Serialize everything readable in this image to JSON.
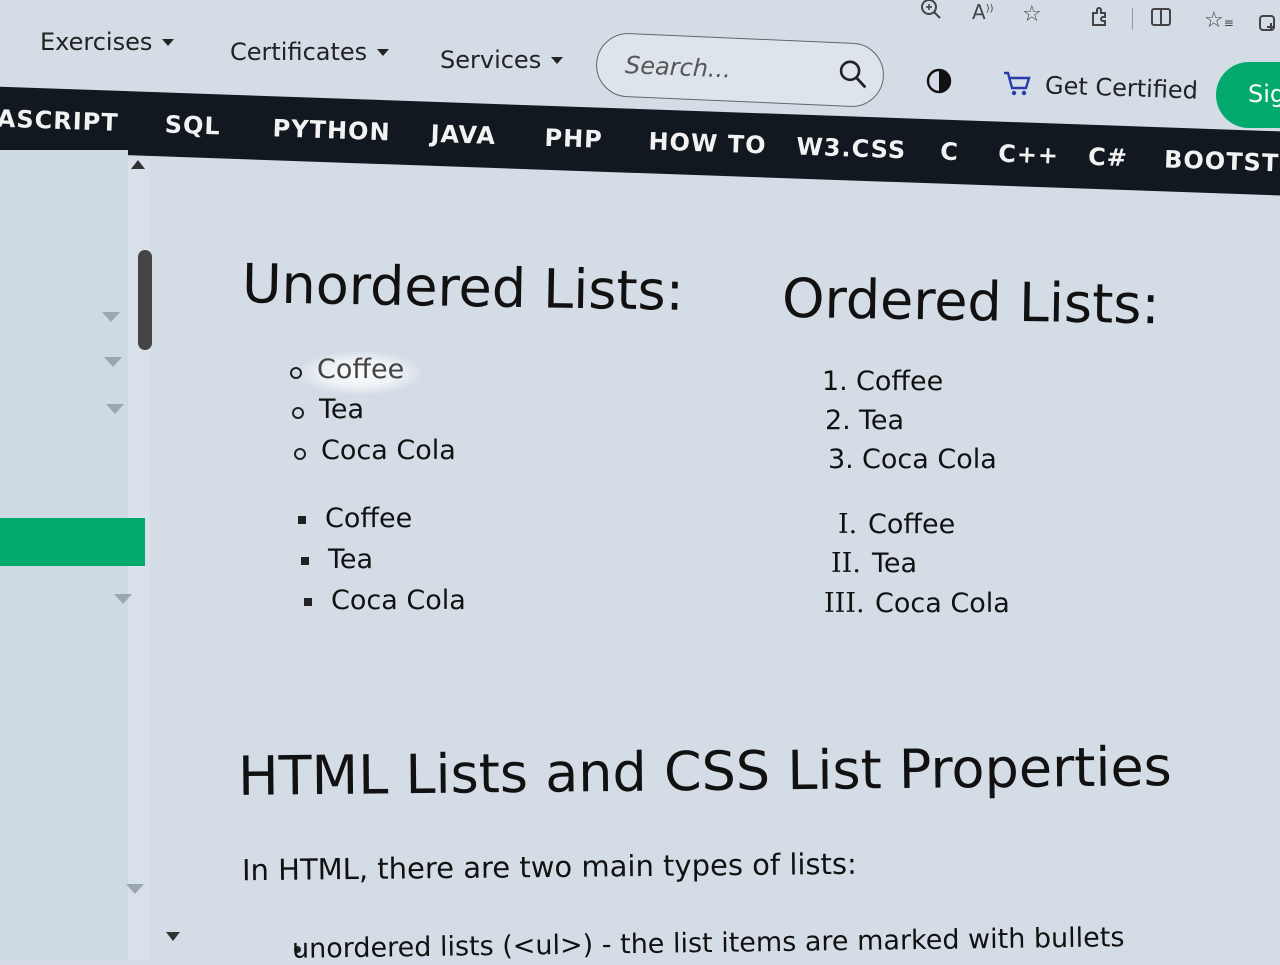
{
  "topnav": {
    "menus": [
      {
        "label": "Exercises"
      },
      {
        "label": "Certificates"
      },
      {
        "label": "Services"
      }
    ],
    "search": {
      "placeholder": "Search..."
    },
    "get_certified": "Get Certified",
    "signup": "Sig"
  },
  "browser_icons": [
    "zoom-in-icon",
    "read-aloud-icon",
    "favorite-star-icon",
    "extensions-icon",
    "split-screen-icon",
    "favorites-list-icon",
    "collections-icon"
  ],
  "langbar": {
    "items": [
      "ASCRIPT",
      "SQL",
      "PYTHON",
      "JAVA",
      "PHP",
      "HOW TO",
      "W3.CSS",
      "C",
      "C++",
      "C#",
      "BOOTSTRA"
    ]
  },
  "content": {
    "unordered_title": "Unordered Lists:",
    "ordered_title": "Ordered Lists:",
    "ul_circle": [
      "Coffee",
      "Tea",
      "Coca Cola"
    ],
    "ul_square": [
      "Coffee",
      "Tea",
      "Coca Cola"
    ],
    "ol_decimal": {
      "markers": [
        "1.",
        "2.",
        "3."
      ],
      "items": [
        "Coffee",
        "Tea",
        "Coca Cola"
      ]
    },
    "ol_roman": {
      "markers": [
        "I.",
        "II.",
        "III."
      ],
      "items": [
        "Coffee",
        "Tea",
        "Coca Cola"
      ]
    },
    "section_title": "HTML Lists and CSS List Properties",
    "intro": "In HTML, there are two main types of lists:",
    "first_bullet": "unordered lists (<ul>) - the list items are marked with bullets"
  },
  "colors": {
    "accent": "#04aa6d",
    "langbar_bg": "#111820",
    "page_bg": "#d4dde6"
  }
}
